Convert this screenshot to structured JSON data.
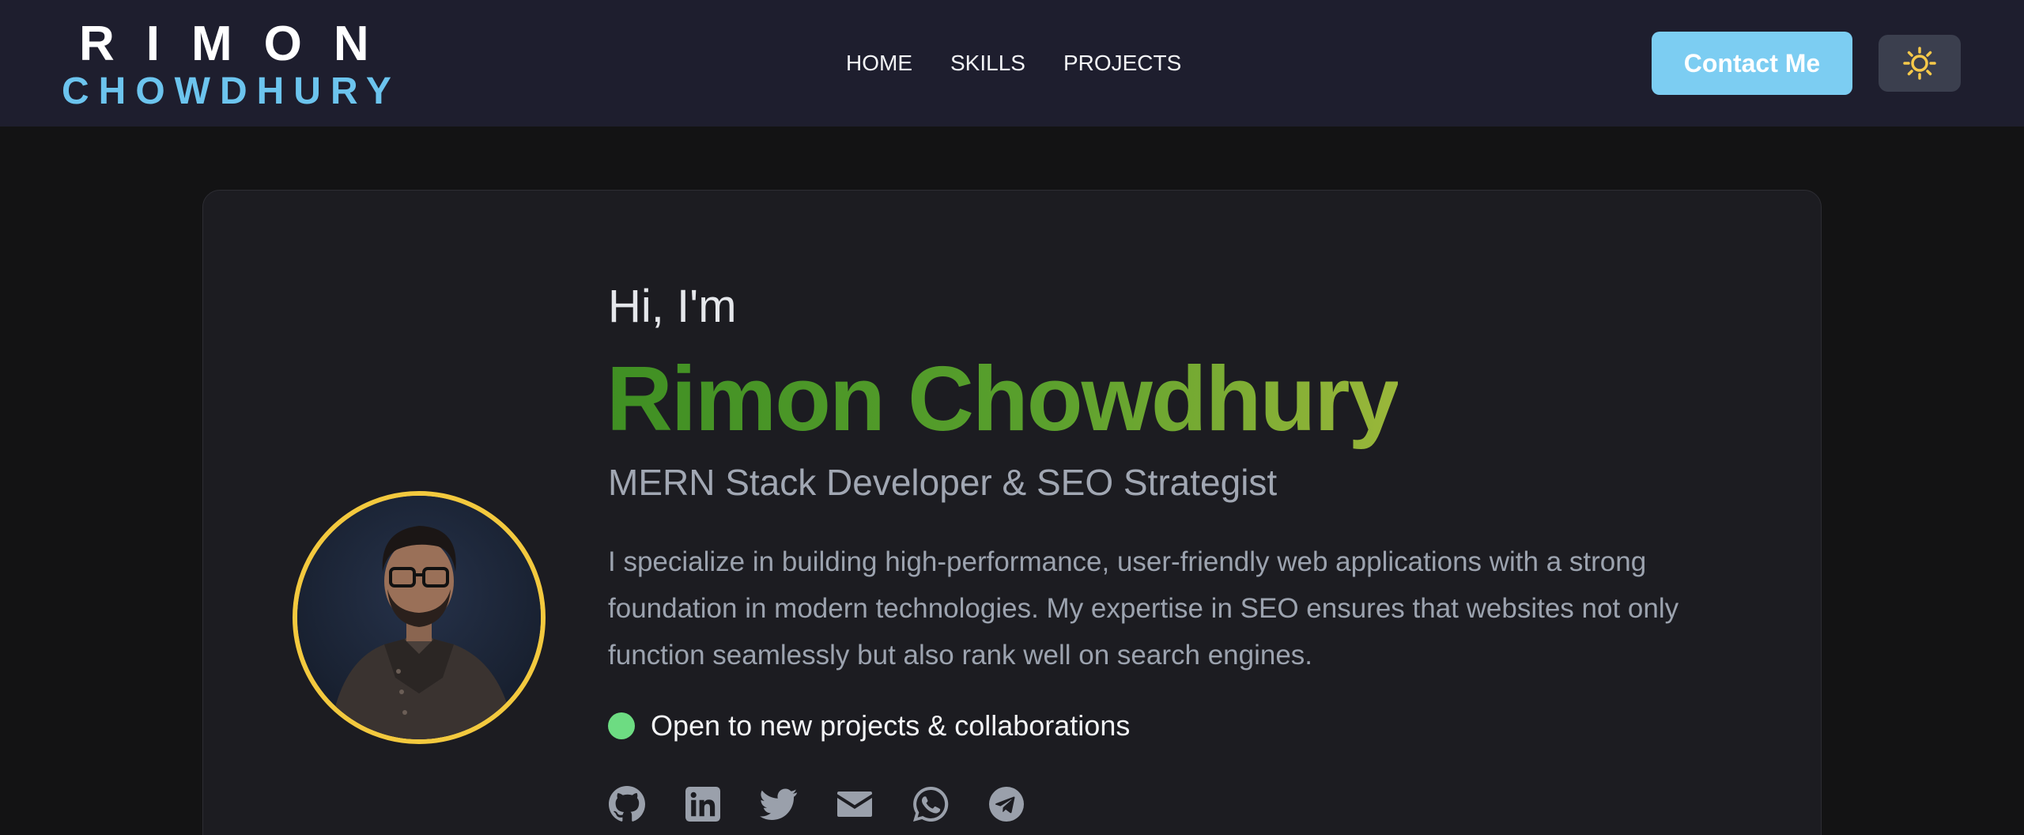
{
  "navbar": {
    "logo_top": "RIMON",
    "logo_bottom": "CHOWDHURY",
    "links": [
      "HOME",
      "SKILLS",
      "PROJECTS"
    ],
    "contact_label": "Contact Me",
    "theme_icon": "sun-icon"
  },
  "hero": {
    "greeting": "Hi, I'm",
    "name": "Rimon Chowdhury",
    "role": "MERN Stack Developer & SEO Strategist",
    "bio": "I specialize in building high-performance, user-friendly web applications with a strong foundation in modern technologies. My expertise in SEO ensures that websites not only function seamlessly but also rank well on search engines.",
    "status": "Open to new projects & collaborations",
    "socials": [
      "github-icon",
      "linkedin-icon",
      "twitter-icon",
      "email-icon",
      "whatsapp-icon",
      "telegram-icon"
    ]
  },
  "colors": {
    "accent_blue": "#7ccdf2",
    "name_gradient_start": "#3f8f23",
    "name_gradient_end": "#9ab73a",
    "avatar_ring": "#f3c93e",
    "status_green": "#6ddc82",
    "sun_yellow": "#f6c94a"
  }
}
